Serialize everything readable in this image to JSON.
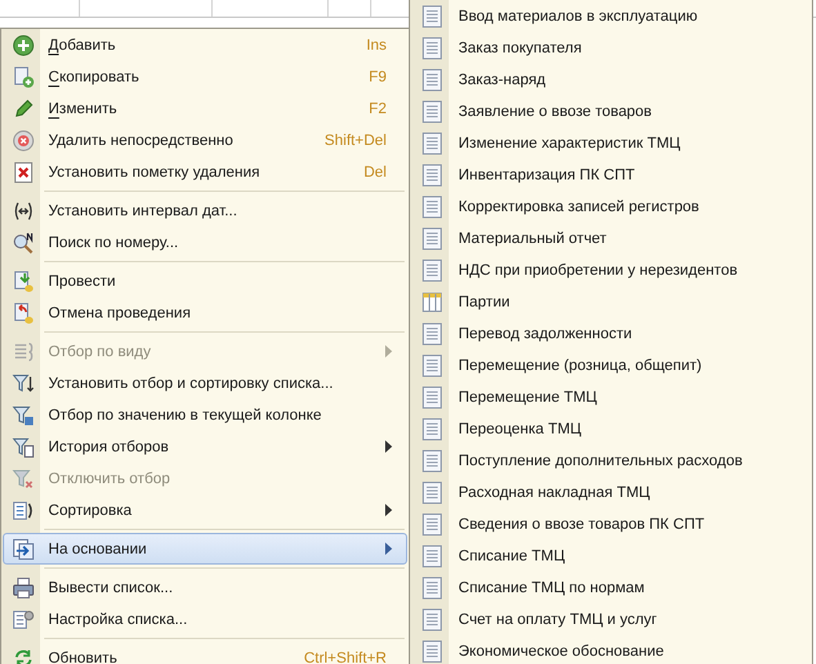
{
  "context_menu": {
    "items": [
      {
        "kind": "item",
        "label": "Добавить",
        "underline_first": true,
        "shortcut": "Ins",
        "disabled": false,
        "submenu": false,
        "selected": false
      },
      {
        "kind": "item",
        "label": "Скопировать",
        "underline_first": true,
        "shortcut": "F9",
        "disabled": false,
        "submenu": false,
        "selected": false
      },
      {
        "kind": "item",
        "label": "Изменить",
        "underline_first": true,
        "shortcut": "F2",
        "disabled": false,
        "submenu": false,
        "selected": false
      },
      {
        "kind": "item",
        "label": "Удалить непосредственно",
        "underline_first": false,
        "shortcut": "Shift+Del",
        "disabled": false,
        "submenu": false,
        "selected": false
      },
      {
        "kind": "item",
        "label": "Установить пометку удаления",
        "underline_first": false,
        "shortcut": "Del",
        "disabled": false,
        "submenu": false,
        "selected": false
      },
      {
        "kind": "separator"
      },
      {
        "kind": "item",
        "label": "Установить интервал дат...",
        "underline_first": false,
        "disabled": false,
        "submenu": false,
        "selected": false
      },
      {
        "kind": "item",
        "label": "Поиск по номеру...",
        "underline_first": false,
        "disabled": false,
        "submenu": false,
        "selected": false
      },
      {
        "kind": "separator"
      },
      {
        "kind": "item",
        "label": "Провести",
        "underline_first": false,
        "disabled": false,
        "submenu": false,
        "selected": false
      },
      {
        "kind": "item",
        "label": "Отмена проведения",
        "underline_first": false,
        "disabled": false,
        "submenu": false,
        "selected": false
      },
      {
        "kind": "separator"
      },
      {
        "kind": "item",
        "label": "Отбор по виду",
        "underline_first": false,
        "disabled": true,
        "submenu": true,
        "selected": false
      },
      {
        "kind": "item",
        "label": "Установить отбор и сортировку списка...",
        "underline_first": false,
        "disabled": false,
        "submenu": false,
        "selected": false
      },
      {
        "kind": "item",
        "label": "Отбор по значению в текущей колонке",
        "underline_first": false,
        "disabled": false,
        "submenu": false,
        "selected": false
      },
      {
        "kind": "item",
        "label": "История отборов",
        "underline_first": false,
        "disabled": false,
        "submenu": true,
        "selected": false
      },
      {
        "kind": "item",
        "label": "Отключить отбор",
        "underline_first": false,
        "disabled": true,
        "submenu": false,
        "selected": false
      },
      {
        "kind": "item",
        "label": "Сортировка",
        "underline_first": false,
        "disabled": false,
        "submenu": true,
        "selected": false
      },
      {
        "kind": "separator"
      },
      {
        "kind": "item",
        "label": "На основании",
        "underline_first": false,
        "disabled": false,
        "submenu": true,
        "selected": true
      },
      {
        "kind": "separator"
      },
      {
        "kind": "item",
        "label": "Вывести список...",
        "underline_first": false,
        "disabled": false,
        "submenu": false,
        "selected": false
      },
      {
        "kind": "item",
        "label": "Настройка списка...",
        "underline_first": false,
        "disabled": false,
        "submenu": false,
        "selected": false
      },
      {
        "kind": "separator"
      },
      {
        "kind": "item",
        "label": "Обновить",
        "underline_first": false,
        "shortcut": "Ctrl+Shift+R",
        "disabled": false,
        "submenu": false,
        "selected": false
      }
    ]
  },
  "submenu": {
    "items": [
      {
        "kind": "document",
        "label": "Ввод материалов в эксплуатацию"
      },
      {
        "kind": "document",
        "label": "Заказ покупателя"
      },
      {
        "kind": "document",
        "label": "Заказ-наряд"
      },
      {
        "kind": "document",
        "label": "Заявление о ввозе товаров"
      },
      {
        "kind": "document",
        "label": "Изменение характеристик ТМЦ"
      },
      {
        "kind": "document",
        "label": "Инвентаризация ПК СПТ"
      },
      {
        "kind": "document",
        "label": "Корректировка записей регистров"
      },
      {
        "kind": "document",
        "label": "Материальный отчет"
      },
      {
        "kind": "document",
        "label": "НДС при приобретении у нерезидентов"
      },
      {
        "kind": "table",
        "label": "Партии"
      },
      {
        "kind": "document",
        "label": "Перевод задолженности"
      },
      {
        "kind": "document",
        "label": "Перемещение (розница, общепит)"
      },
      {
        "kind": "document",
        "label": "Перемещение ТМЦ"
      },
      {
        "kind": "document",
        "label": "Переоценка ТМЦ"
      },
      {
        "kind": "document",
        "label": "Поступление дополнительных расходов"
      },
      {
        "kind": "document",
        "label": "Расходная накладная ТМЦ"
      },
      {
        "kind": "document",
        "label": "Сведения о ввозе товаров ПК СПТ"
      },
      {
        "kind": "document",
        "label": "Списание ТМЦ"
      },
      {
        "kind": "document",
        "label": "Списание ТМЦ по нормам"
      },
      {
        "kind": "document",
        "label": "Счет на оплату ТМЦ и услуг"
      },
      {
        "kind": "document",
        "label": "Экономическое обоснование"
      }
    ]
  }
}
